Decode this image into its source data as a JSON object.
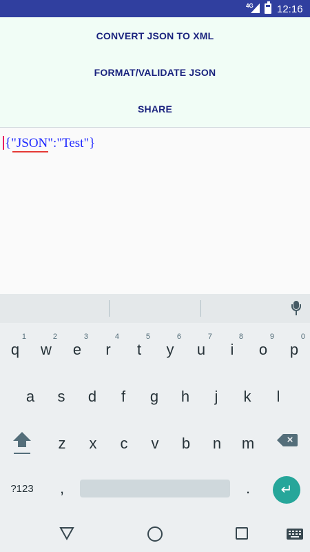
{
  "status_bar": {
    "network": "4G",
    "time": "12:16",
    "background": "#303f9f"
  },
  "actions": {
    "convert_label": "CONVERT JSON TO XML",
    "format_label": "FORMAT/VALIDATE JSON",
    "share_label": "SHARE",
    "text_color": "#1a237e",
    "background": "#f1fdf6"
  },
  "editor": {
    "value": "{\"JSON\":\"Test\"}",
    "text_color": "#1f28ff",
    "spellcheck_underline_word": "JSON"
  },
  "keyboard": {
    "rows": [
      [
        {
          "ch": "q",
          "hint": "1"
        },
        {
          "ch": "w",
          "hint": "2"
        },
        {
          "ch": "e",
          "hint": "3"
        },
        {
          "ch": "r",
          "hint": "4"
        },
        {
          "ch": "t",
          "hint": "5"
        },
        {
          "ch": "y",
          "hint": "6"
        },
        {
          "ch": "u",
          "hint": "7"
        },
        {
          "ch": "i",
          "hint": "8"
        },
        {
          "ch": "o",
          "hint": "9"
        },
        {
          "ch": "p",
          "hint": "0"
        }
      ],
      [
        {
          "ch": "a"
        },
        {
          "ch": "s"
        },
        {
          "ch": "d"
        },
        {
          "ch": "f"
        },
        {
          "ch": "g"
        },
        {
          "ch": "h"
        },
        {
          "ch": "j"
        },
        {
          "ch": "k"
        },
        {
          "ch": "l"
        }
      ],
      [
        {
          "ch": "z"
        },
        {
          "ch": "x"
        },
        {
          "ch": "c"
        },
        {
          "ch": "v"
        },
        {
          "ch": "b"
        },
        {
          "ch": "n"
        },
        {
          "ch": "m"
        }
      ]
    ],
    "symbols_label": "?123",
    "comma_label": ",",
    "period_label": ".",
    "enter_icon": "enter-arrow-icon",
    "shift_icon": "shift-icon",
    "backspace_icon": "backspace-icon",
    "mic_icon": "microphone-icon",
    "accent_color": "#26a69a"
  },
  "nav_bar": {
    "back_icon": "back-triangle-icon",
    "home_icon": "home-circle-icon",
    "recents_icon": "recents-square-icon",
    "keyboard_icon": "keyboard-switch-icon"
  }
}
